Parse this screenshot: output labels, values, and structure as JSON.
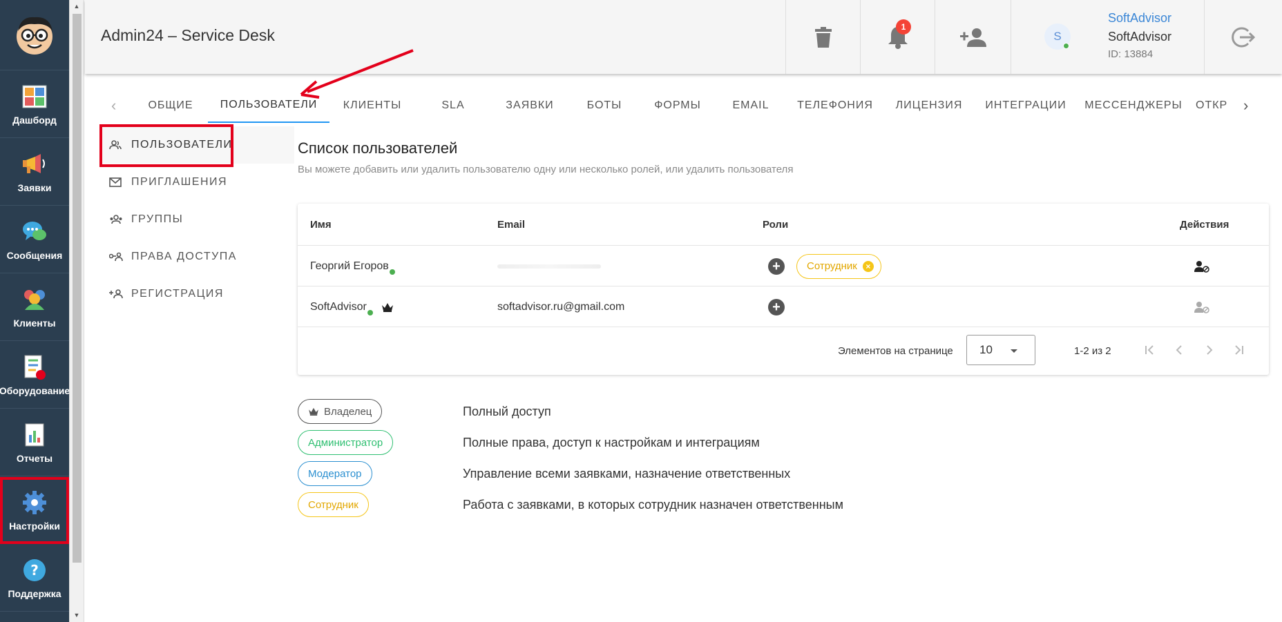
{
  "app": {
    "title": "Admin24 – Service Desk"
  },
  "sidebar": {
    "items": [
      {
        "label": "Дашборд",
        "icon": "dashboard-icon"
      },
      {
        "label": "Заявки",
        "icon": "megaphone-icon"
      },
      {
        "label": "Сообщения",
        "icon": "chat-bubble-icon"
      },
      {
        "label": "Клиенты",
        "icon": "clients-icon"
      },
      {
        "label": "Оборудование",
        "icon": "equipment-checklist-icon"
      },
      {
        "label": "Отчеты",
        "icon": "report-icon"
      },
      {
        "label": "Настройки",
        "icon": "gear-icon",
        "active": true
      },
      {
        "label": "Поддержка",
        "icon": "help-icon"
      }
    ]
  },
  "header": {
    "notifications_count": "1",
    "user": {
      "link": "SoftAdvisor",
      "name": "SoftAdvisor",
      "id": "ID: 13884",
      "avatar_letter": "S"
    }
  },
  "tabs": [
    {
      "label": "Общие"
    },
    {
      "label": "Пользователи",
      "active": true
    },
    {
      "label": "Клиенты"
    },
    {
      "label": "SLA"
    },
    {
      "label": "Заявки"
    },
    {
      "label": "Боты"
    },
    {
      "label": "Формы"
    },
    {
      "label": "Email"
    },
    {
      "label": "Телефония"
    },
    {
      "label": "Лицензия"
    },
    {
      "label": "Интеграции"
    },
    {
      "label": "Мессенджеры"
    },
    {
      "label": "Откр"
    }
  ],
  "submenu": [
    {
      "label": "Пользователи",
      "icon": "users-icon",
      "active": true
    },
    {
      "label": "Приглашения",
      "icon": "mail-icon"
    },
    {
      "label": "Группы",
      "icon": "group-icon"
    },
    {
      "label": "Права доступа",
      "icon": "access-key-icon"
    },
    {
      "label": "Регистрация",
      "icon": "add-person-icon"
    }
  ],
  "main": {
    "title": "Список пользователей",
    "subtitle": "Вы можете добавить или удалить пользователю одну или несколько ролей, или удалить пользователя"
  },
  "table": {
    "headers": {
      "name": "Имя",
      "email": "Email",
      "roles": "Роли",
      "actions": "Действия"
    },
    "rows": [
      {
        "name": "Георгий Егоров",
        "email": "",
        "role": "Сотрудник",
        "owner": false
      },
      {
        "name": "SoftAdvisor",
        "email": "softadvisor.ru@gmail.com",
        "role": "",
        "owner": true
      }
    ],
    "pager": {
      "label": "Элементов на странице",
      "page_size": "10",
      "range": "1-2 из 2"
    }
  },
  "legend": [
    {
      "role": "Владелец",
      "desc": "Полный доступ",
      "color": "#555555"
    },
    {
      "role": "Администратор",
      "desc": "Полные права, доступ к настройкам и интеграциям",
      "color": "#2fbf71"
    },
    {
      "role": "Модератор",
      "desc": "Управление всеми заявками, назначение ответственных",
      "color": "#2a8fd0"
    },
    {
      "role": "Сотрудник",
      "desc": "Работа с заявками, в которых сотрудник назначен ответственным",
      "color": "#e2a700"
    }
  ],
  "colors": {
    "sidebar": "#2b3e50",
    "accent": "#2196f3",
    "highlight": "#e3001b"
  }
}
